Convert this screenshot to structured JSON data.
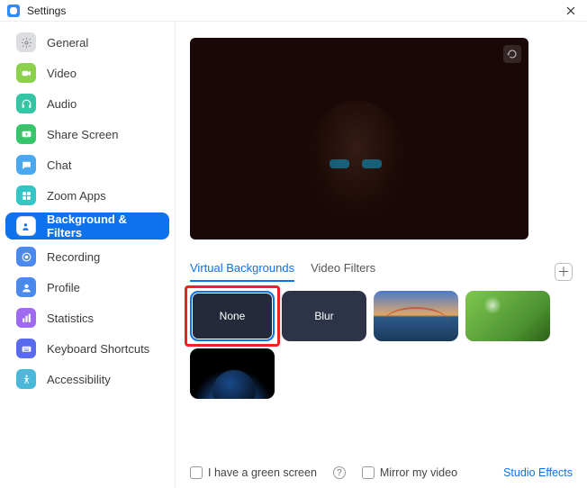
{
  "window": {
    "title": "Settings"
  },
  "sidebar": {
    "items": [
      {
        "label": "General"
      },
      {
        "label": "Video"
      },
      {
        "label": "Audio"
      },
      {
        "label": "Share Screen"
      },
      {
        "label": "Chat"
      },
      {
        "label": "Zoom Apps"
      },
      {
        "label": "Background & Filters"
      },
      {
        "label": "Recording"
      },
      {
        "label": "Profile"
      },
      {
        "label": "Statistics"
      },
      {
        "label": "Keyboard Shortcuts"
      },
      {
        "label": "Accessibility"
      }
    ],
    "active_index": 6
  },
  "tabs": {
    "virtual_backgrounds": "Virtual Backgrounds",
    "video_filters": "Video Filters",
    "active": "virtual_backgrounds"
  },
  "backgrounds": {
    "none_label": "None",
    "blur_label": "Blur",
    "selected": "none",
    "items": [
      "none",
      "blur",
      "bridge",
      "grass",
      "earth"
    ]
  },
  "footer": {
    "green_screen": "I have a green screen",
    "mirror": "Mirror my video",
    "studio_effects": "Studio Effects"
  }
}
